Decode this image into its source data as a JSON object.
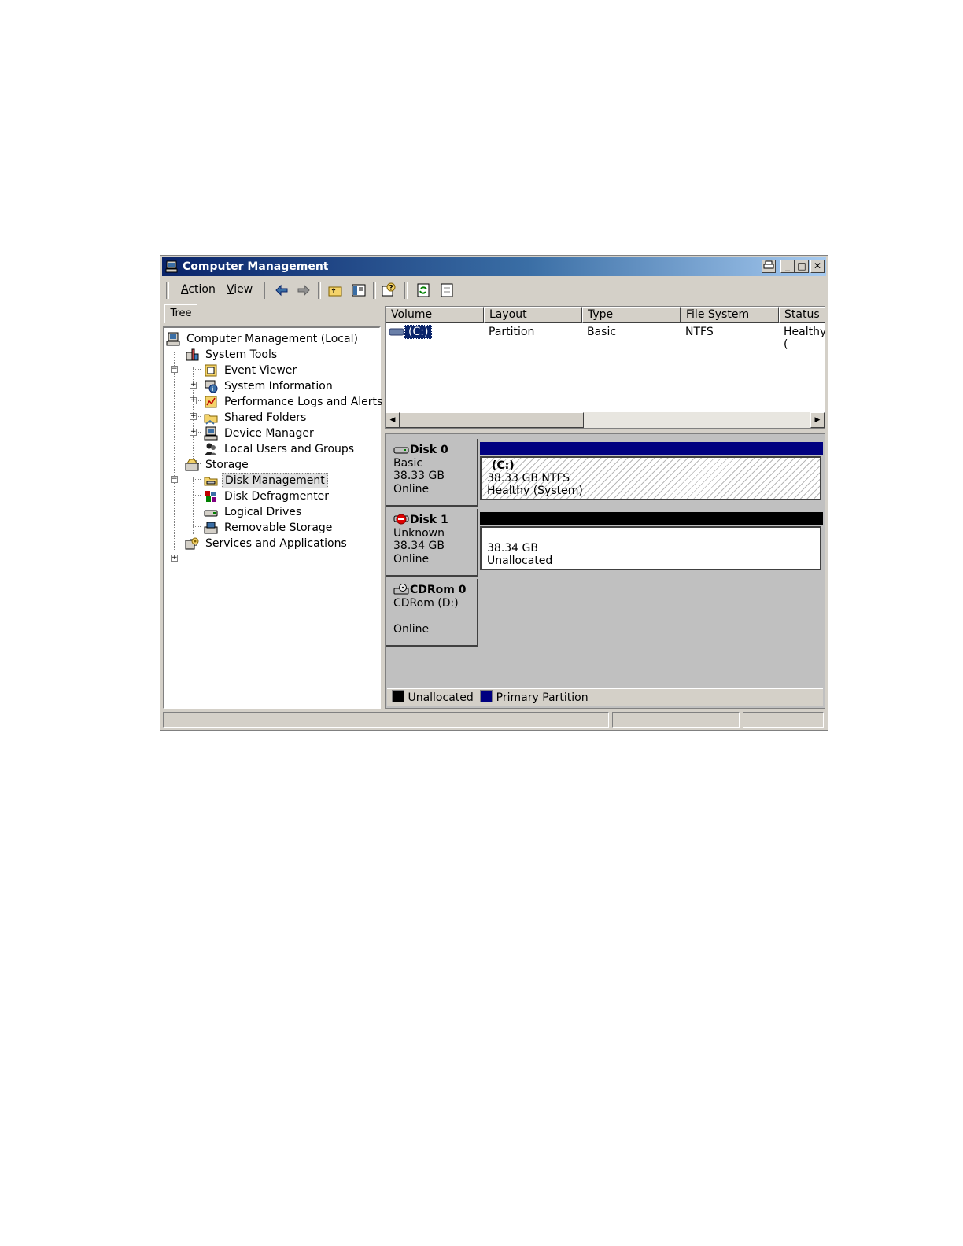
{
  "window": {
    "title": "Computer Management"
  },
  "menu": {
    "action": "Action",
    "action_key": "A",
    "view": "View",
    "view_key": "V"
  },
  "tree_tab": "Tree",
  "tree": [
    {
      "label": "Computer Management (Local)"
    },
    {
      "label": "System Tools"
    },
    {
      "label": "Event Viewer"
    },
    {
      "label": "System Information"
    },
    {
      "label": "Performance Logs and Alerts"
    },
    {
      "label": "Shared Folders"
    },
    {
      "label": "Device Manager"
    },
    {
      "label": "Local Users and Groups"
    },
    {
      "label": "Storage"
    },
    {
      "label": "Disk Management",
      "selected": true
    },
    {
      "label": "Disk Defragmenter"
    },
    {
      "label": "Logical Drives"
    },
    {
      "label": "Removable Storage"
    },
    {
      "label": "Services and Applications"
    }
  ],
  "volume_list": {
    "columns": [
      "Volume",
      "Layout",
      "Type",
      "File System",
      "Status"
    ],
    "rows": [
      {
        "volume": "(C:)",
        "layout": "Partition",
        "type": "Basic",
        "fs": "NTFS",
        "status": "Healthy ("
      }
    ]
  },
  "disks": [
    {
      "name": "Disk 0",
      "type": "Basic",
      "size": "38.33 GB",
      "status": "Online",
      "partition": {
        "label": "(C:)",
        "detail": "38.33 GB NTFS",
        "state": "Healthy (System)"
      }
    },
    {
      "name": "Disk 1",
      "type": "Unknown",
      "size": "38.34 GB",
      "status": "Online",
      "partition": {
        "label": "",
        "detail": "38.34 GB",
        "state": "Unallocated"
      }
    },
    {
      "name": "CDRom 0",
      "type": "CDRom (D:)",
      "size": "",
      "status": "Online"
    }
  ],
  "legend": [
    {
      "label": "Unallocated",
      "color": "#000000"
    },
    {
      "label": "Primary Partition",
      "color": "#000080"
    }
  ],
  "colors": {
    "primary_partition": "#000080",
    "unallocated": "#000000",
    "titlebar": "#0a246a"
  }
}
